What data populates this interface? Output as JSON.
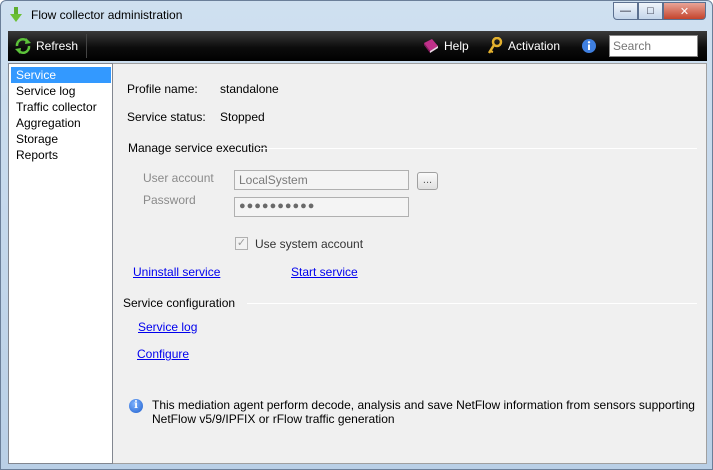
{
  "window": {
    "title": "Flow collector administration",
    "minimize_glyph": "—",
    "maximize_glyph": "□",
    "close_glyph": "✕"
  },
  "toolbar": {
    "refresh_label": "Refresh",
    "help_label": "Help",
    "activation_label": "Activation",
    "search_placeholder": "Search"
  },
  "sidebar": {
    "items": [
      {
        "label": "Service",
        "selected": true
      },
      {
        "label": "Service log"
      },
      {
        "label": "Traffic collector"
      },
      {
        "label": "Aggregation"
      },
      {
        "label": "Storage"
      },
      {
        "label": "Reports"
      }
    ]
  },
  "service": {
    "profile_name_label": "Profile name:",
    "profile_name_value": "standalone",
    "status_label": "Service status:",
    "status_value": "Stopped",
    "manage_group_title": "Manage service execution",
    "user_account_label": "User account",
    "user_account_value": "LocalSystem",
    "browse_label": "...",
    "password_label": "Password",
    "password_value": "●●●●●●●●●●",
    "use_system_account_label": "Use system account",
    "use_system_account_checked": true,
    "uninstall_link": "Uninstall service",
    "start_link": "Start service",
    "config_group_title": "Service configuration",
    "service_log_link": "Service log",
    "configure_link": "Configure",
    "info_text": "This mediation agent perform decode, analysis and save NetFlow information from sensors supporting NetFlow v5/9/IPFIX or rFlow traffic generation"
  },
  "colors": {
    "selection": "#3399ff",
    "link": "#0000ee",
    "toolbar_bg": "#000000"
  }
}
